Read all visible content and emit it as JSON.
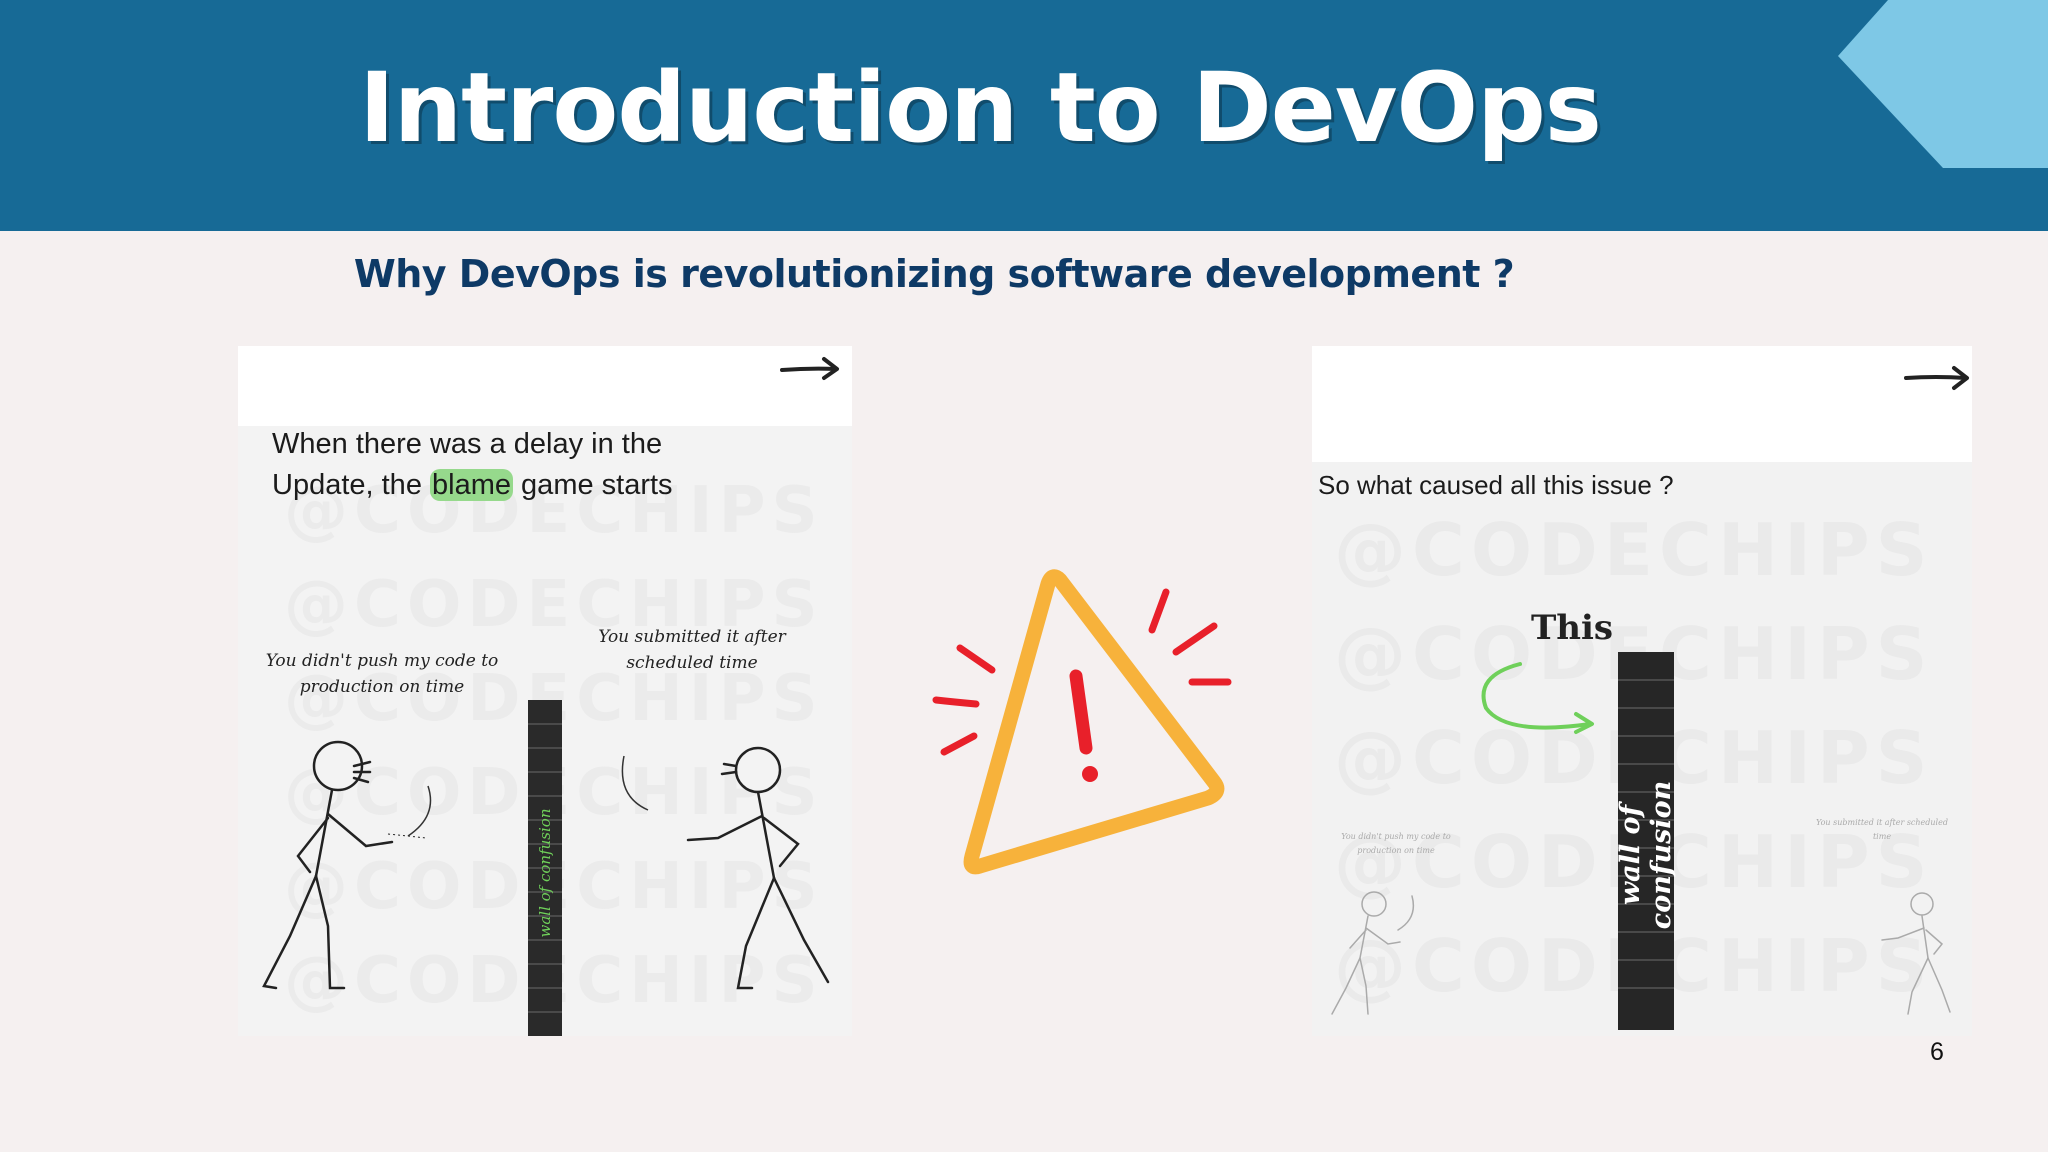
{
  "slide": {
    "title": "Introduction to DevOps",
    "subtitle": "Why DevOps is revolutionizing software development ?",
    "page_number": "6"
  },
  "left_panel": {
    "caption_before": "When there was a delay in the",
    "caption_mid": "Update, the ",
    "caption_highlight": "blame",
    "caption_after": " game starts",
    "speech_left": "You didn't push my code to production on time",
    "speech_right": "You submitted it after scheduled time",
    "wall_label": "wall of confusion",
    "watermark": "@CODECHIPS"
  },
  "right_panel": {
    "caption": "So what caused all this issue ?",
    "pointer_label": "This",
    "wall_label": "wall of confusion",
    "speech_left": "You didn't push my code to production on time",
    "speech_right": "You submitted it after scheduled time",
    "watermark": "@CODECHIPS"
  },
  "icons": {
    "warning": "warning-triangle-icon",
    "next": "arrow-right-icon"
  },
  "colors": {
    "header": "#176a96",
    "accent": "#7ec8e6",
    "subtitle": "#0e3a66",
    "warning_stroke": "#f7b23b",
    "warning_mark": "#e8202a",
    "highlight": "#96d98c"
  }
}
